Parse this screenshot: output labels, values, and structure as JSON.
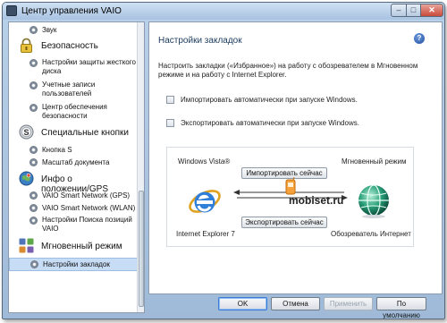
{
  "window": {
    "title": "Центр управления VAIO"
  },
  "sidebar": {
    "top_item": "Звук",
    "categories": [
      {
        "label": "Безопасность",
        "items": [
          "Настройки защиты жесткого диска",
          "Учетные записи пользователей",
          "Центр обеспечения безопасности"
        ]
      },
      {
        "label": "Специальные кнопки",
        "items": [
          "Кнопка S",
          "Масштаб документа"
        ]
      },
      {
        "label": "Инфо о положении/GPS",
        "items": [
          "VAIO Smart Network (GPS)",
          "VAIO Smart Network (WLAN)",
          "Настройки Поиска позиций VAIO"
        ]
      },
      {
        "label": "Мгновенный режим",
        "items": [
          "Настройки закладок"
        ]
      }
    ],
    "selected_item": "Настройки закладок"
  },
  "main": {
    "title": "Настройки закладок",
    "help_icon": "?",
    "description": "Настроить закладки («Избранное») на работу с обозревателем в Мгновенном режиме и на работу с Internet Explorer.",
    "checkboxes": [
      {
        "label": "Импортировать автоматически при запуске Windows.",
        "checked": false
      },
      {
        "label": "Экспортировать автоматически при запуске Windows.",
        "checked": false
      }
    ],
    "diagram": {
      "left_title": "Windows Vista®",
      "right_title": "Мгновенный режим",
      "import_button": "Импортировать сейчас",
      "export_button": "Экспортировать сейчас",
      "left_caption": "Internet Explorer 7",
      "right_caption": "Обозреватель Интернет",
      "watermark": "mobiset.ru"
    }
  },
  "footer": {
    "ok": "OK",
    "cancel": "Отмена",
    "apply": "Применить",
    "defaults": "По умолчанию"
  },
  "colors": {
    "accent": "#1f4fa0",
    "selection": "#c7dcf5",
    "window_frame": "#a9c3e2"
  }
}
